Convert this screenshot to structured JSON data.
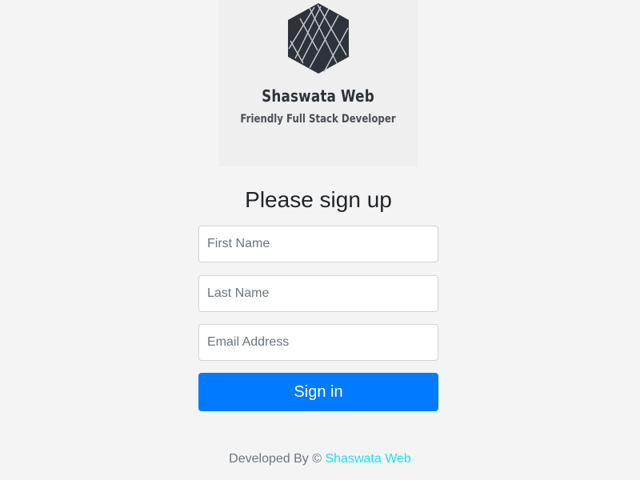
{
  "brand": {
    "name": "Shaswata Web",
    "tagline": "Friendly Full Stack Developer",
    "logo_icon": "hexagon-lattice-logo",
    "logo_color": "#2e333b"
  },
  "form": {
    "heading": "Please sign up",
    "first_name_placeholder": "First Name",
    "last_name_placeholder": "Last Name",
    "email_placeholder": "Email Address",
    "submit_label": "Sign in",
    "accent_color": "#007bff"
  },
  "footer": {
    "prefix": "Developed By ©",
    "link_text": "Shaswata Web",
    "link_color": "#17e4f2"
  }
}
